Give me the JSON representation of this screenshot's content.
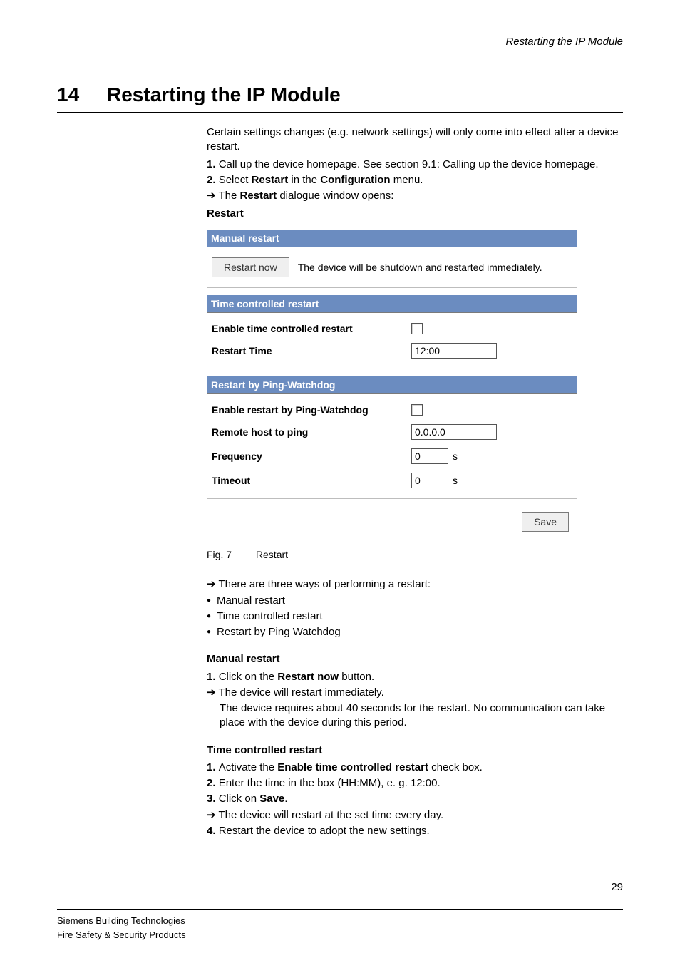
{
  "running_header": "Restarting the IP Module",
  "chapter": {
    "number": "14",
    "title": "Restarting the IP Module"
  },
  "intro": {
    "p1": "Certain settings changes (e.g. network settings) will only come into effect after a device restart.",
    "s1_prefix": "1. ",
    "s1_text": "Call up the device homepage. See section 9.1: Calling up the device homepage.",
    "s2_prefix": "2. ",
    "s2_a": "Select ",
    "s2_b_bold": "Restart",
    "s2_c": " in the ",
    "s2_d_bold": "Configuration",
    "s2_e": " menu.",
    "arr_a": "The ",
    "arr_b_bold": "Restart",
    "arr_c": " dialogue window opens:"
  },
  "dialog": {
    "title": "Restart",
    "manual": {
      "header": "Manual restart",
      "button": "Restart now",
      "desc": "The device will be shutdown and restarted immediately."
    },
    "time": {
      "header": "Time controlled restart",
      "enable_label": "Enable time controlled restart",
      "time_label": "Restart Time",
      "time_value": "12:00"
    },
    "ping": {
      "header": "Restart by Ping-Watchdog",
      "enable_label": "Enable restart by Ping-Watchdog",
      "host_label": "Remote host to ping",
      "host_value": "0.0.0.0",
      "freq_label": "Frequency",
      "freq_value": "0",
      "freq_unit": "s",
      "timeout_label": "Timeout",
      "timeout_value": "0",
      "timeout_unit": "s"
    },
    "save_label": "Save"
  },
  "figcap": {
    "num": "Fig. 7",
    "text": "Restart"
  },
  "after": {
    "arr1": "There are three ways of performing a restart:",
    "b1": "Manual restart",
    "b2": "Time controlled restart",
    "b3": "Restart by Ping Watchdog"
  },
  "manual_section": {
    "heading": "Manual restart",
    "s1_prefix": "1. ",
    "s1_a": "Click on the ",
    "s1_b_bold": "Restart now",
    "s1_c": " button.",
    "arr": "The device will restart immediately.",
    "sub": "The device requires about 40 seconds for the restart. No communication can take place with the device during this period."
  },
  "time_section": {
    "heading": "Time controlled restart",
    "s1_prefix": "1. ",
    "s1_a": "Activate the ",
    "s1_b_bold": "Enable time controlled restart",
    "s1_c": " check box.",
    "s2_prefix": "2. ",
    "s2_text": "Enter the time in the box (HH:MM), e. g. 12:00.",
    "s3_prefix": "3. ",
    "s3_a": "Click on ",
    "s3_b_bold": "Save",
    "s3_c": ".",
    "arr": "The device will restart at the set time every day.",
    "s4_prefix": "4. ",
    "s4_text": "Restart the device to adopt the new settings."
  },
  "footer": {
    "line1": "Siemens Building Technologies",
    "line2": "Fire Safety & Security Products",
    "pagenum": "29"
  }
}
